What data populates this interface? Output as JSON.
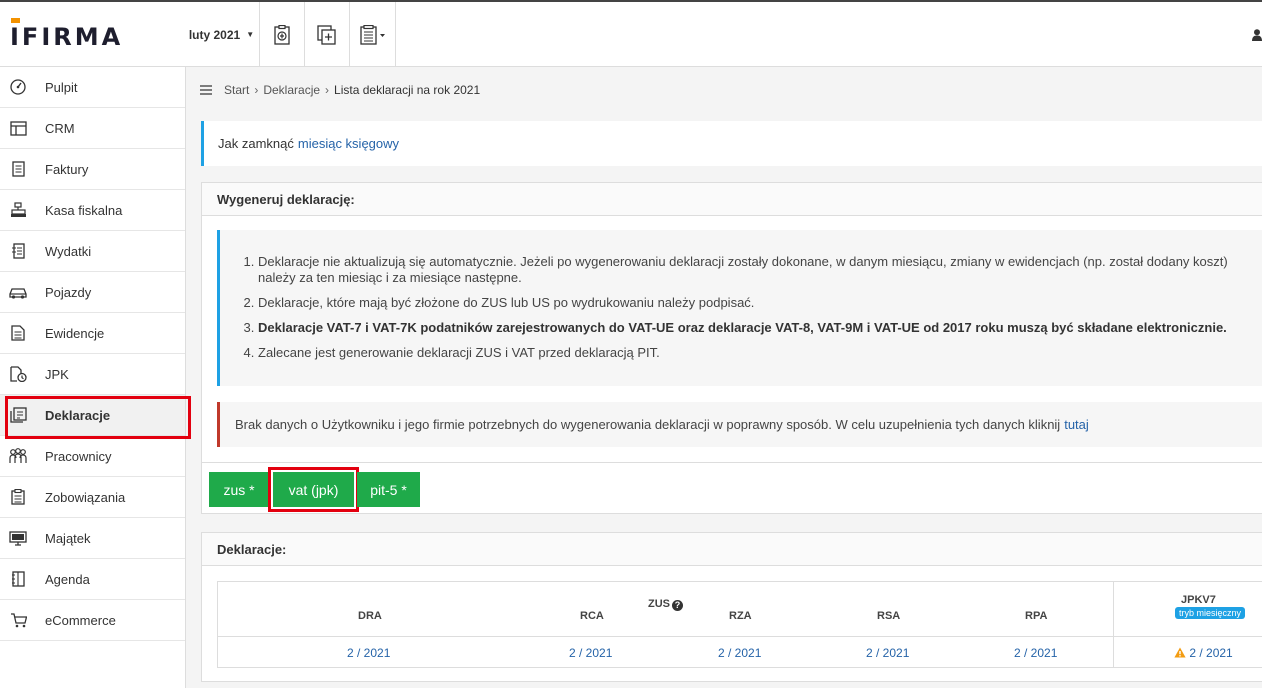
{
  "header": {
    "logo": "IFIRMA",
    "month": "luty 2021",
    "icons": [
      "settlement-icon",
      "add-document-icon",
      "documents-menu-icon",
      "user-icon"
    ]
  },
  "sidebar": {
    "items": [
      {
        "label": "Pulpit",
        "icon": "dashboard-icon"
      },
      {
        "label": "CRM",
        "icon": "crm-icon"
      },
      {
        "label": "Faktury",
        "icon": "invoice-icon"
      },
      {
        "label": "Kasa fiskalna",
        "icon": "cash-register-icon"
      },
      {
        "label": "Wydatki",
        "icon": "expenses-icon"
      },
      {
        "label": "Pojazdy",
        "icon": "car-icon"
      },
      {
        "label": "Ewidencje",
        "icon": "records-icon"
      },
      {
        "label": "JPK",
        "icon": "jpk-icon"
      },
      {
        "label": "Deklaracje",
        "icon": "declarations-icon",
        "active": true
      },
      {
        "label": "Pracownicy",
        "icon": "employees-icon"
      },
      {
        "label": "Zobowiązania",
        "icon": "liabilities-icon"
      },
      {
        "label": "Majątek",
        "icon": "assets-icon"
      },
      {
        "label": "Agenda",
        "icon": "agenda-icon"
      },
      {
        "label": "eCommerce",
        "icon": "cart-icon"
      }
    ]
  },
  "breadcrumb": {
    "items": [
      "Start",
      "Deklaracje",
      "Lista deklaracji na rok 2021"
    ]
  },
  "info": {
    "text": "Jak zamknąć",
    "link": "miesiąc księgowy"
  },
  "generate": {
    "title": "Wygeneruj deklarację:",
    "notices": [
      "Deklaracje nie aktualizują się automatycznie. Jeżeli po wygenerowaniu deklaracji zostały dokonane, w danym miesiącu, zmiany w ewidencjach (np. został dodany koszt) należy za ten miesiąc i za miesiące następne.",
      "Deklaracje, które mają być złożone do ZUS lub US po wydrukowaniu należy podpisać.",
      "Deklaracje VAT-7 i VAT-7K podatników zarejestrowanych do VAT-UE oraz deklaracje VAT-8, VAT-9M i VAT-UE od 2017 roku muszą być składane elektronicznie.",
      "Zalecane jest generowanie deklaracji ZUS i VAT przed deklaracją PIT."
    ],
    "warning": "Brak danych o Użytkowniku i jego firmie potrzebnych do wygenerowania deklaracji w poprawny sposób. W celu uzupełnienia tych danych kliknij",
    "warning_link": "tutaj",
    "buttons": [
      "zus *",
      "vat (jpk)",
      "pit-5 *"
    ],
    "accent": "#1faa4a"
  },
  "declarations": {
    "title": "Deklaracje:",
    "zus_group": "ZUS",
    "jpk_group": "JPKV7",
    "jpk_badge": "tryb miesięczny",
    "columns": [
      "DRA",
      "RCA",
      "RZA",
      "RSA",
      "RPA"
    ],
    "values": [
      "2 / 2021",
      "2 / 2021",
      "2 / 2021",
      "2 / 2021",
      "2 / 2021"
    ],
    "jpk_value": "2 / 2021"
  }
}
